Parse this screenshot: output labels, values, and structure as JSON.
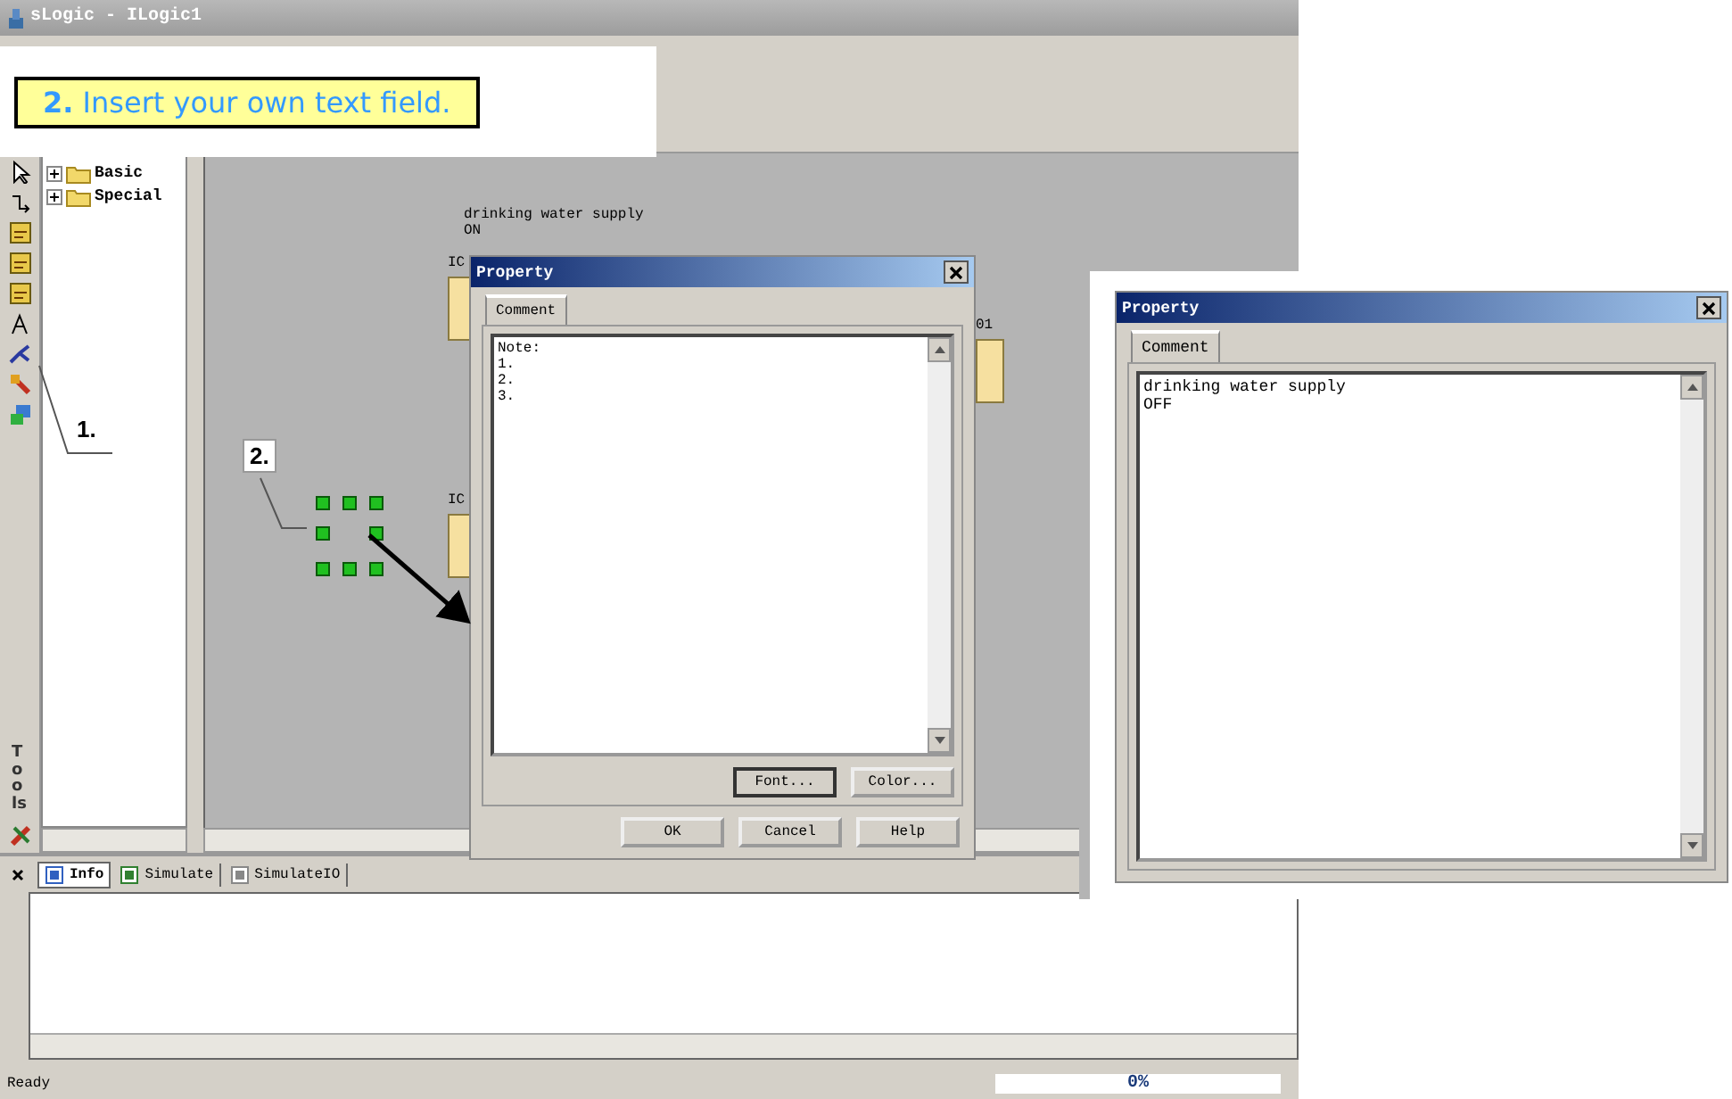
{
  "window": {
    "title": "sLogic - ILogic1"
  },
  "callout": {
    "text": "**2.** Insert your own text field."
  },
  "toolbox": {
    "label": "Tools"
  },
  "tree": {
    "items": [
      {
        "label": "Basic",
        "expanded": false
      },
      {
        "label": "Special",
        "expanded": false
      }
    ]
  },
  "canvas": {
    "comment": [
      "drinking water supply",
      "ON"
    ],
    "blocks": [
      {
        "label": "IC"
      },
      {
        "label": "IC"
      },
      {
        "label": "01"
      }
    ],
    "markers": [
      "1.",
      "2."
    ]
  },
  "dialog": {
    "title": "Property",
    "tabs": [
      {
        "label": "Comment",
        "selected": true
      }
    ],
    "lines": [
      "Note:",
      "1.",
      "2.",
      "3."
    ],
    "buttons": [
      "Font...",
      "Color..."
    ],
    "footer_buttons": [
      "OK",
      "Cancel",
      "Help"
    ]
  },
  "result_dialog": {
    "title": "Property",
    "tabs": [
      {
        "label": "Comment",
        "selected": true
      }
    ],
    "lines": [
      "drinking water supply",
      "OFF"
    ]
  },
  "output_panel": {
    "tabs": [
      {
        "label": "Info",
        "selected": true
      },
      {
        "label": "Simulate",
        "selected": false
      },
      {
        "label": "SimulateIO",
        "selected": false
      }
    ]
  },
  "status_bar": {
    "message": "Ready",
    "progress": "0%"
  }
}
